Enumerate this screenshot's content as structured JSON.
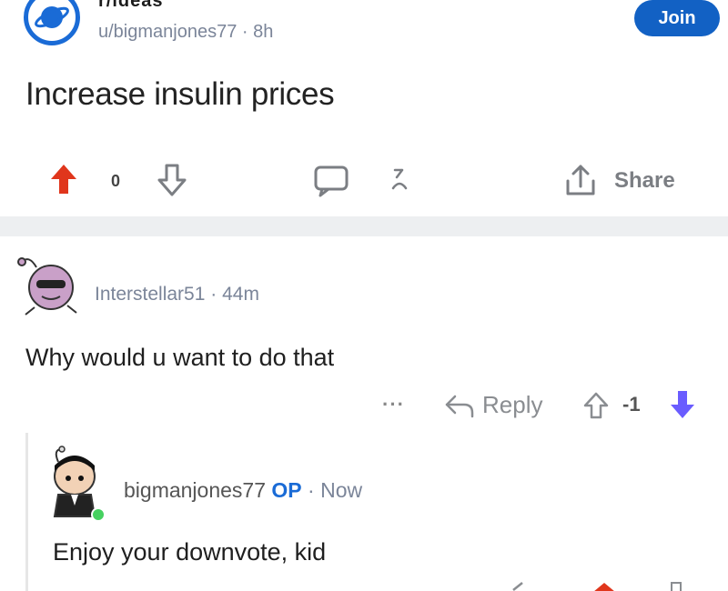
{
  "post": {
    "subreddit_partial": "r/ideas",
    "author": "u/bigmanjones77",
    "separator": "·",
    "age": "8h",
    "join_label": "Join",
    "title": "Increase insulin prices",
    "vote_count": "0",
    "share_label": "Share"
  },
  "comments": [
    {
      "author": "Interstellar51",
      "separator": "·",
      "age": "44m",
      "body": "Why would u want to do that",
      "more_label": "···",
      "reply_label": "Reply",
      "score": "-1"
    },
    {
      "author": "bigmanjones77",
      "op_label": "OP",
      "separator": "·",
      "age": "Now",
      "body": "Enjoy your downvote, kid"
    }
  ],
  "colors": {
    "upvote_active": "#e0361c",
    "downvote_active": "#6a5cff",
    "brand_blue": "#1261c4",
    "online": "#46d160"
  }
}
